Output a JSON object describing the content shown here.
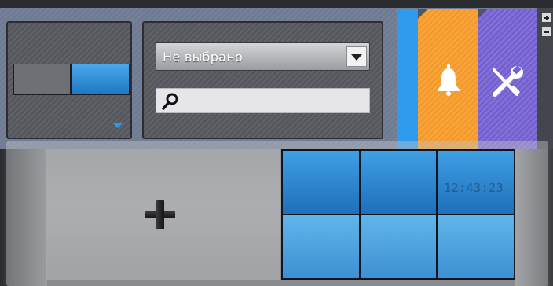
{
  "layouts_panel": {
    "mini_layout_icons": [
      "single-gray-cell",
      "single-blue-cell"
    ],
    "dropdown_icon": "triangle-down-icon"
  },
  "camera_filter": {
    "select_value": "Не выбрано",
    "search_value": "",
    "search_icon": "magnifier-icon"
  },
  "side_tiles": {
    "alerts_icon": "bell-icon",
    "settings_icon": "wrench-screwdriver-icon",
    "colors": {
      "alerts": "#f59a28",
      "settings": "#7460d0",
      "accent": "#2f9bec"
    }
  },
  "layout_gallery": {
    "add_icon": "plus-icon",
    "grid_layout": {
      "rows": 2,
      "cols": 3
    },
    "timestamp": "12:43:23"
  }
}
